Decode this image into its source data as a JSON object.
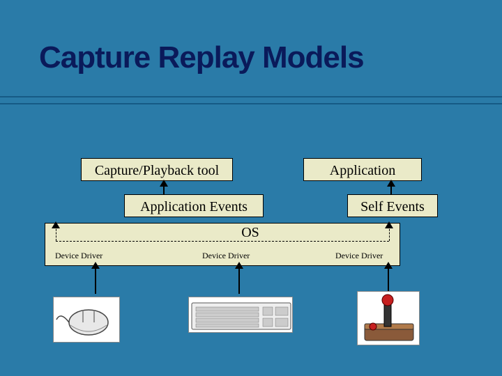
{
  "title": "Capture Replay Models",
  "boxes": {
    "capture_playback": "Capture/Playback tool",
    "application": "Application",
    "application_events": "Application Events",
    "self_events": "Self Events",
    "os": "OS",
    "device_driver_1": "Device Driver",
    "device_driver_2": "Device Driver",
    "device_driver_3": "Device Driver"
  },
  "devices": {
    "mouse": "mouse",
    "keyboard": "keyboard",
    "joystick": "joystick"
  },
  "colors": {
    "background": "#2a7ba8",
    "box_fill": "#eaeac8",
    "title_text": "#0a1a5a"
  }
}
